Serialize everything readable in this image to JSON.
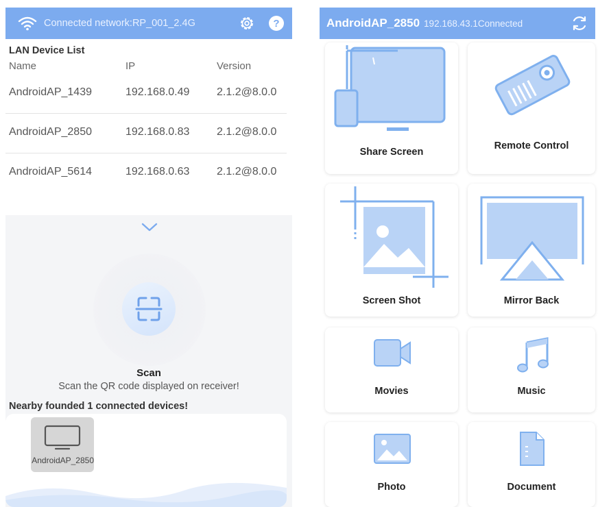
{
  "left_panel": {
    "network_label": "Connected network:RP_001_2.4G",
    "help_label": "?",
    "lan_title": "LAN Device List",
    "columns": {
      "name": "Name",
      "ip": "IP",
      "version": "Version"
    },
    "devices": [
      {
        "name": "AndroidAP_1439",
        "ip": "192.168.0.49",
        "version": "2.1.2@8.0.0"
      },
      {
        "name": "AndroidAP_2850",
        "ip": "192.168.0.83",
        "version": "2.1.2@8.0.0"
      },
      {
        "name": "AndroidAP_5614",
        "ip": "192.168.0.63",
        "version": "2.1.2@8.0.0"
      }
    ],
    "scan": {
      "title": "Scan",
      "subtitle": "Scan the QR code displayed on receiver!"
    },
    "nearby_text": "Nearby founded 1 connected devices!",
    "nearby_device": "AndroidAP_2850"
  },
  "right_panel": {
    "device_name": "AndroidAP_2850",
    "ip_status": "192.168.43.1Connected",
    "tiles": [
      {
        "label": "Share Screen",
        "icon": "share-screen-icon"
      },
      {
        "label": "Remote Control",
        "icon": "projector-icon"
      },
      {
        "label": "Screen Shot",
        "icon": "crop-image-icon"
      },
      {
        "label": "Mirror Back",
        "icon": "mirror-back-icon"
      },
      {
        "label": "Movies",
        "icon": "video-camera-icon"
      },
      {
        "label": "Music",
        "icon": "music-note-icon"
      },
      {
        "label": "Photo",
        "icon": "photo-icon"
      },
      {
        "label": "Document",
        "icon": "document-icon"
      }
    ]
  },
  "colors": {
    "accent": "#7cabef",
    "icon_blue": "#a9c9f5",
    "icon_blue_dark": "#7fb0ee"
  }
}
